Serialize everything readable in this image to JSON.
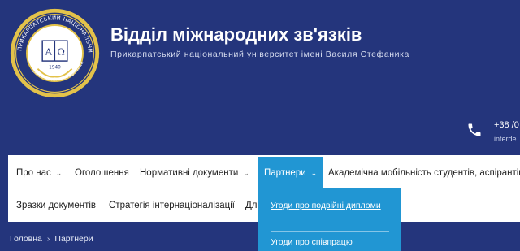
{
  "header": {
    "title": "Відділ міжнародних зв'язків",
    "subtitle": "Прикарпатський національний університет імені Василя Стефаника",
    "logo_ring_text": "ПРИКАРПАТСЬКИЙ НАЦІОНАЛЬНИЙ УНІВЕРСИТЕТ",
    "logo_bottom_text": "імені Василя Стефаника",
    "logo_year": "1940",
    "logo_letters": [
      "Α",
      "Ω"
    ]
  },
  "contact": {
    "phone": "+38 /0",
    "email": "interde"
  },
  "nav": {
    "row1": [
      {
        "label": "Про нас",
        "chevron": true
      },
      {
        "label": "Оголошення",
        "chevron": false
      },
      {
        "label": "Нормативні документи",
        "chevron": true
      },
      {
        "label": "Партнери",
        "chevron": true,
        "active": true
      },
      {
        "label": "Академічна мобільність студентів, аспірантів",
        "chevron": false
      }
    ],
    "row2": [
      {
        "label": "Зразки документів"
      },
      {
        "label": "Стратегія інтернаціоналізації"
      },
      {
        "label": "Дл"
      }
    ]
  },
  "dropdown": {
    "items": [
      "Угоди про подвійні дипломи",
      "Угоди про співпрацю"
    ]
  },
  "breadcrumb": {
    "home": "Головна",
    "separator": "›",
    "current": "Партнери"
  },
  "colors": {
    "background": "#24357c",
    "accent": "#2196d3",
    "logo_gold": "#e3c24a"
  },
  "icons": [
    "phone-icon",
    "chevron-down-icon",
    "university-logo"
  ]
}
